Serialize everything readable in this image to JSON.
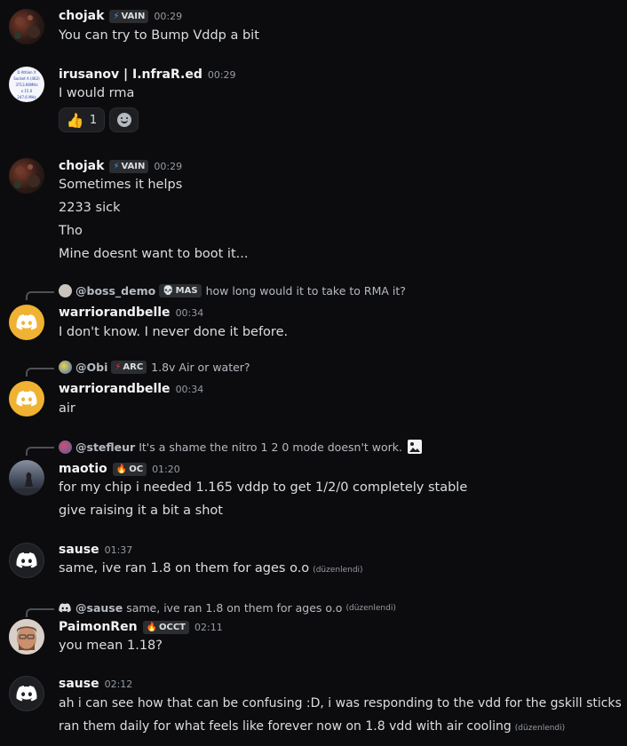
{
  "messages": {
    "m1": {
      "author": "chojak",
      "tag": "VAIN",
      "time": "00:29",
      "lines": [
        "You can try to Bump Vddp a bit"
      ]
    },
    "m2": {
      "author": "irusanov | I.nfraR.ed",
      "time": "00:29",
      "lines": [
        "I would rma"
      ],
      "avatar_text": [
        "D Athlon X",
        "Socket A (462)",
        "3713.66MHz",
        "x 15.0",
        "247.6 MHz"
      ],
      "reactions": [
        {
          "emoji": "thumbs-up",
          "count": "1"
        }
      ]
    },
    "m3": {
      "author": "chojak",
      "tag": "VAIN",
      "time": "00:29",
      "lines": [
        "Sometimes it helps",
        "2233 sick",
        "Tho",
        "Mine doesnt want to boot it..."
      ]
    },
    "m4": {
      "reply_to": "@boss_demo",
      "reply_tag": "MAS",
      "reply_text": "how long would it to take to RMA it?",
      "author": "warriorandbelle",
      "time": "00:34",
      "lines": [
        "I don't know. I never done it before."
      ]
    },
    "m5": {
      "reply_to": "@Obi",
      "reply_tag": "ARC",
      "reply_text": "1.8v Air or water?",
      "author": "warriorandbelle",
      "time": "00:34",
      "lines": [
        "air"
      ]
    },
    "m6": {
      "reply_to": "@stefleur",
      "reply_text": "It's a shame the nitro 1 2 0 mode doesn't work.",
      "author": "maotio",
      "tag": "OC",
      "time": "01:20",
      "lines": [
        "for my chip i needed 1.165 vddp to get 1/2/0 completely stable",
        "give raising it a bit a shot"
      ]
    },
    "m7": {
      "author": "sause",
      "time": "01:37",
      "lines": [
        "same, ive ran 1.8 on them for ages o.o"
      ],
      "edited": "(düzenlendi)"
    },
    "m8": {
      "reply_to": "@sause",
      "reply_text": "same, ive ran 1.8 on them for ages o.o",
      "reply_edited": "(düzenlendi)",
      "author": "PaimonRen",
      "tag": "OCCT",
      "time": "02:11",
      "lines": [
        "you mean 1.18?"
      ]
    },
    "m9": {
      "author": "sause",
      "time": "02:12",
      "lines": [
        "ah i can see how that can be confusing :D, i was responding to the vdd for the gskill sticks",
        "ran them daily for what feels like forever now on 1.8 vdd with air cooling"
      ],
      "edited": "(düzenlendi)"
    }
  },
  "colors": {
    "background": "#0c0c0e",
    "discord_yellow": "#f0b232",
    "tag_bg": "#2b2d31",
    "lightning": "#3aa0ff"
  }
}
